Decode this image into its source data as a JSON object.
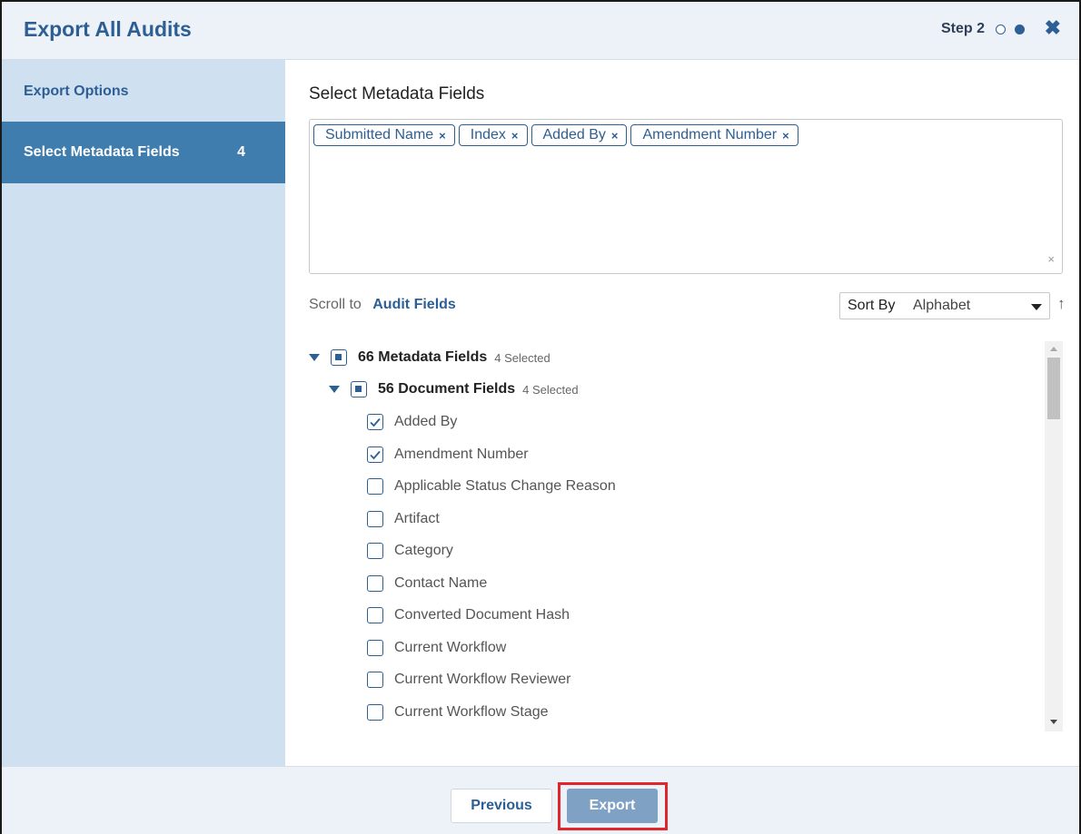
{
  "header": {
    "title": "Export All Audits",
    "step_label": "Step 2",
    "close_icon": "close-icon"
  },
  "sidebar": {
    "items": [
      {
        "label": "Export Options",
        "count": ""
      },
      {
        "label": "Select Metadata Fields",
        "count": "4",
        "active": true
      }
    ]
  },
  "main": {
    "section_title": "Select Metadata Fields",
    "tags": [
      {
        "label": "Submitted Name",
        "remove": "×"
      },
      {
        "label": "Index",
        "remove": "×"
      },
      {
        "label": "Added By",
        "remove": "×"
      },
      {
        "label": "Amendment Number",
        "remove": "×"
      }
    ],
    "clear_all": "×",
    "scroll_to_label": "Scroll to",
    "scroll_to_link": "Audit Fields",
    "sort_by_label": "Sort By",
    "sort_by_value": "Alphabet",
    "sort_direction_icon": "↑",
    "tree": {
      "root": {
        "label": "66 Metadata Fields",
        "selected": "4 Selected"
      },
      "group": {
        "label": "56 Document Fields",
        "selected": "4 Selected"
      },
      "fields": [
        {
          "label": "Added By",
          "checked": true
        },
        {
          "label": "Amendment Number",
          "checked": true
        },
        {
          "label": "Applicable Status Change Reason",
          "checked": false
        },
        {
          "label": "Artifact",
          "checked": false
        },
        {
          "label": "Category",
          "checked": false
        },
        {
          "label": "Contact Name",
          "checked": false
        },
        {
          "label": "Converted Document Hash",
          "checked": false
        },
        {
          "label": "Current Workflow",
          "checked": false
        },
        {
          "label": "Current Workflow Reviewer",
          "checked": false
        },
        {
          "label": "Current Workflow Stage",
          "checked": false
        }
      ]
    }
  },
  "footer": {
    "previous_label": "Previous",
    "export_label": "Export"
  },
  "colors": {
    "accent": "#2d5f94",
    "sidebar_bg": "#cfe0f1",
    "sidebar_active": "#3f7dae",
    "export_button": "#7ea1c4",
    "highlight": "#e0262a"
  }
}
